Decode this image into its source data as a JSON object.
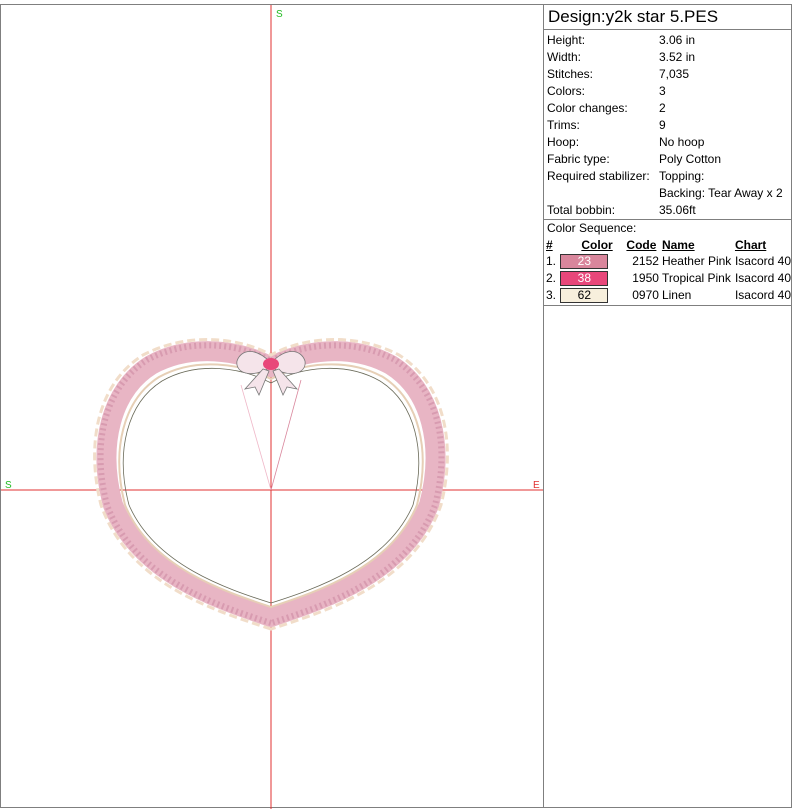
{
  "title": "Design:y2k star 5.PES",
  "properties": [
    {
      "label": "Height:",
      "value": "3.06 in"
    },
    {
      "label": "Width:",
      "value": "3.52 in"
    },
    {
      "label": "Stitches:",
      "value": "7,035"
    },
    {
      "label": "Colors:",
      "value": "3"
    },
    {
      "label": "Color changes:",
      "value": "2"
    },
    {
      "label": "Trims:",
      "value": "9"
    },
    {
      "label": "Hoop:",
      "value": "No hoop"
    },
    {
      "label": "Fabric type:",
      "value": "Poly Cotton"
    },
    {
      "label": "Required stabilizer:",
      "value": "Topping:",
      "value2": "Backing: Tear Away x 2"
    },
    {
      "label": "Total bobbin:",
      "value": "35.06ft"
    }
  ],
  "color_sequence": {
    "title": "Color Sequence:",
    "headers": {
      "num": "#",
      "color": "Color",
      "code": "Code",
      "name": "Name",
      "chart": "Chart"
    },
    "rows": [
      {
        "num": "1.",
        "swatch": "23",
        "hex": "#d9869c",
        "text_color": "#ffffff",
        "code": "2152",
        "name": "Heather Pink",
        "chart": "Isacord 40"
      },
      {
        "num": "2.",
        "swatch": "38",
        "hex": "#e8477a",
        "text_color": "#ffffff",
        "code": "1950",
        "name": "Tropical Pink",
        "chart": "Isacord 40"
      },
      {
        "num": "3.",
        "swatch": "62",
        "hex": "#f7efdc",
        "text_color": "#000000",
        "code": "0970",
        "name": "Linen",
        "chart": "Isacord 40"
      }
    ]
  },
  "canvas": {
    "axis_color": "#e03030",
    "label_top": "S",
    "label_left": "S",
    "label_right": "E",
    "label_color_green": "#22bb22",
    "label_color_red": "#e03030"
  }
}
